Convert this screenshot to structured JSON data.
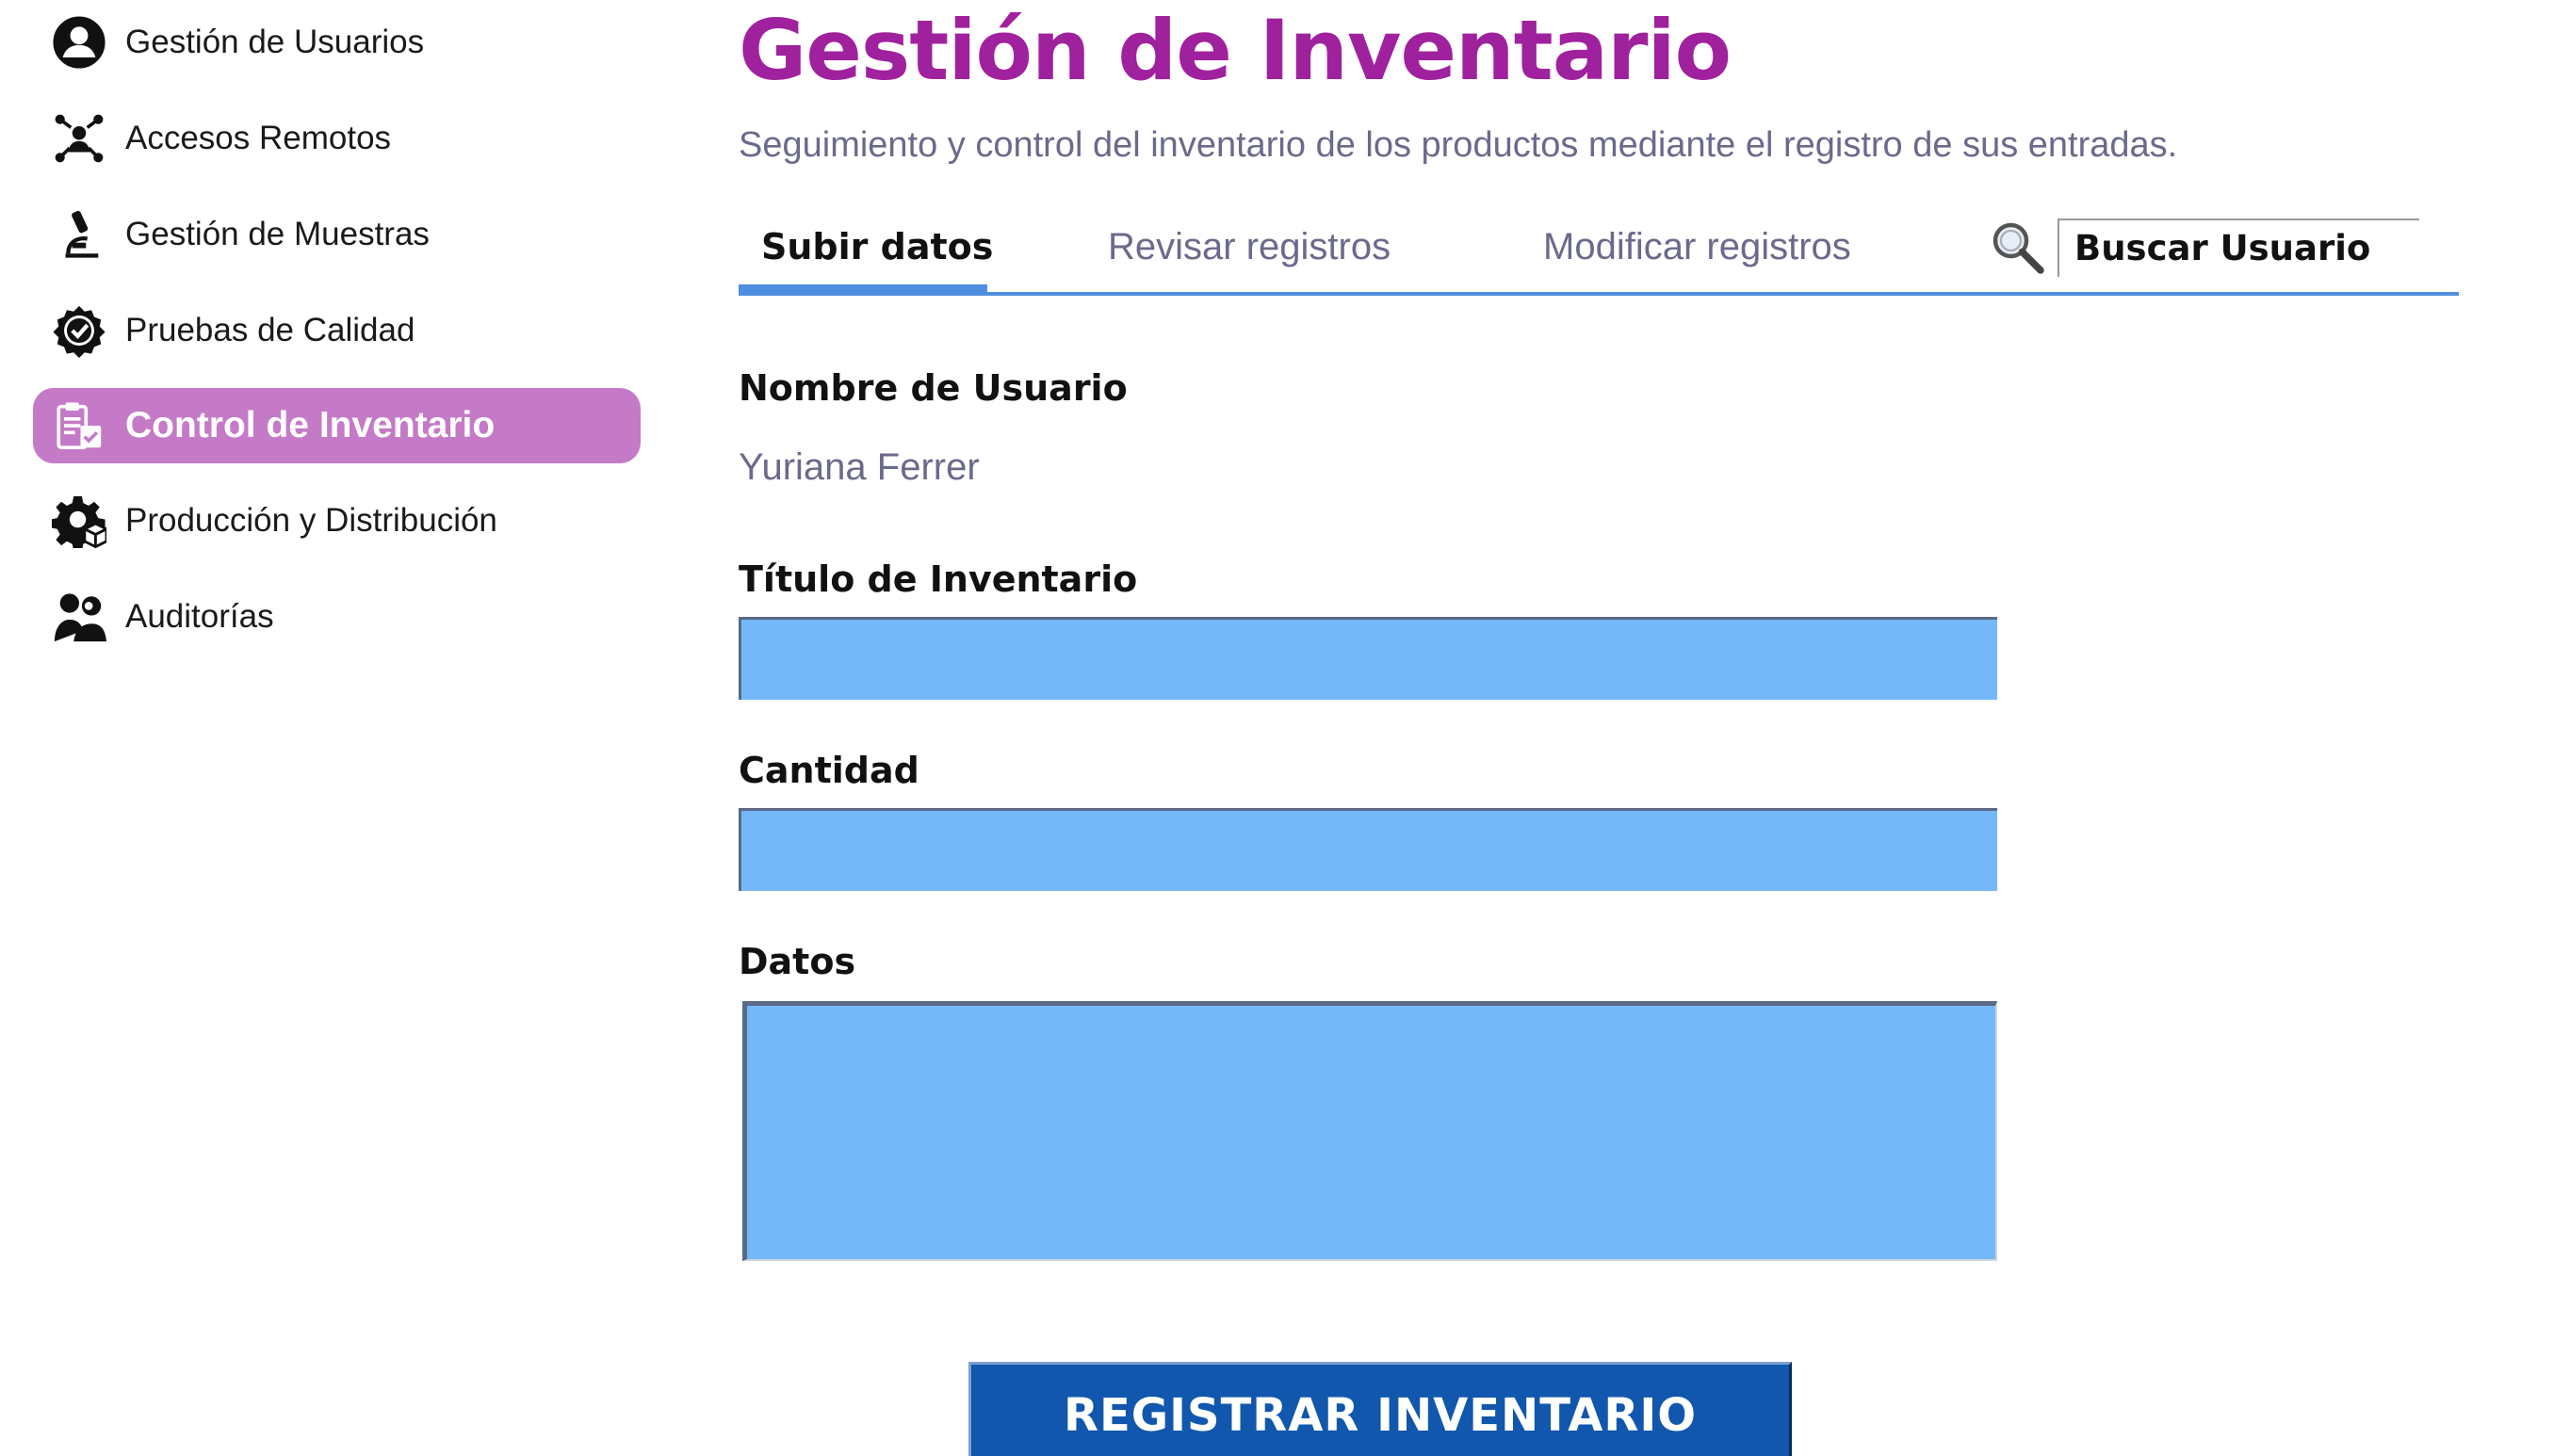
{
  "sidebar": {
    "items": [
      {
        "label": "Gestión de Usuarios",
        "icon": "user-circle-icon"
      },
      {
        "label": "Accesos Remotos",
        "icon": "network-icon"
      },
      {
        "label": "Gestión de Muestras",
        "icon": "microscope-icon"
      },
      {
        "label": "Pruebas de Calidad",
        "icon": "badge-check-icon"
      },
      {
        "label": "Control de Inventario",
        "icon": "clipboard-icon",
        "active": true
      },
      {
        "label": "Producción y Distribución",
        "icon": "gear-box-icon"
      },
      {
        "label": "Auditorías",
        "icon": "people-icon"
      }
    ]
  },
  "header": {
    "title": "Gestión de Inventario",
    "subtitle": "Seguimiento y control del inventario de los productos mediante el registro de sus entradas."
  },
  "tabs": [
    {
      "label": "Subir datos",
      "active": true
    },
    {
      "label": "Revisar registros"
    },
    {
      "label": "Modificar registros"
    }
  ],
  "search": {
    "value": "Buscar Usuario",
    "icon": "search-icon"
  },
  "form": {
    "user_label": "Nombre de Usuario",
    "user_value": "Yuriana Ferrer",
    "title_label": "Título de Inventario",
    "title_value": "",
    "quantity_label": "Cantidad",
    "quantity_value": "",
    "data_label": "Datos",
    "data_value": "",
    "submit_label": "REGISTRAR INVENTARIO"
  },
  "colors": {
    "accent": "#a0219d",
    "active_nav": "#c57ac7",
    "input_fill": "#74b8fa",
    "tab_line": "#4f8fe0",
    "button": "#1057ad"
  }
}
